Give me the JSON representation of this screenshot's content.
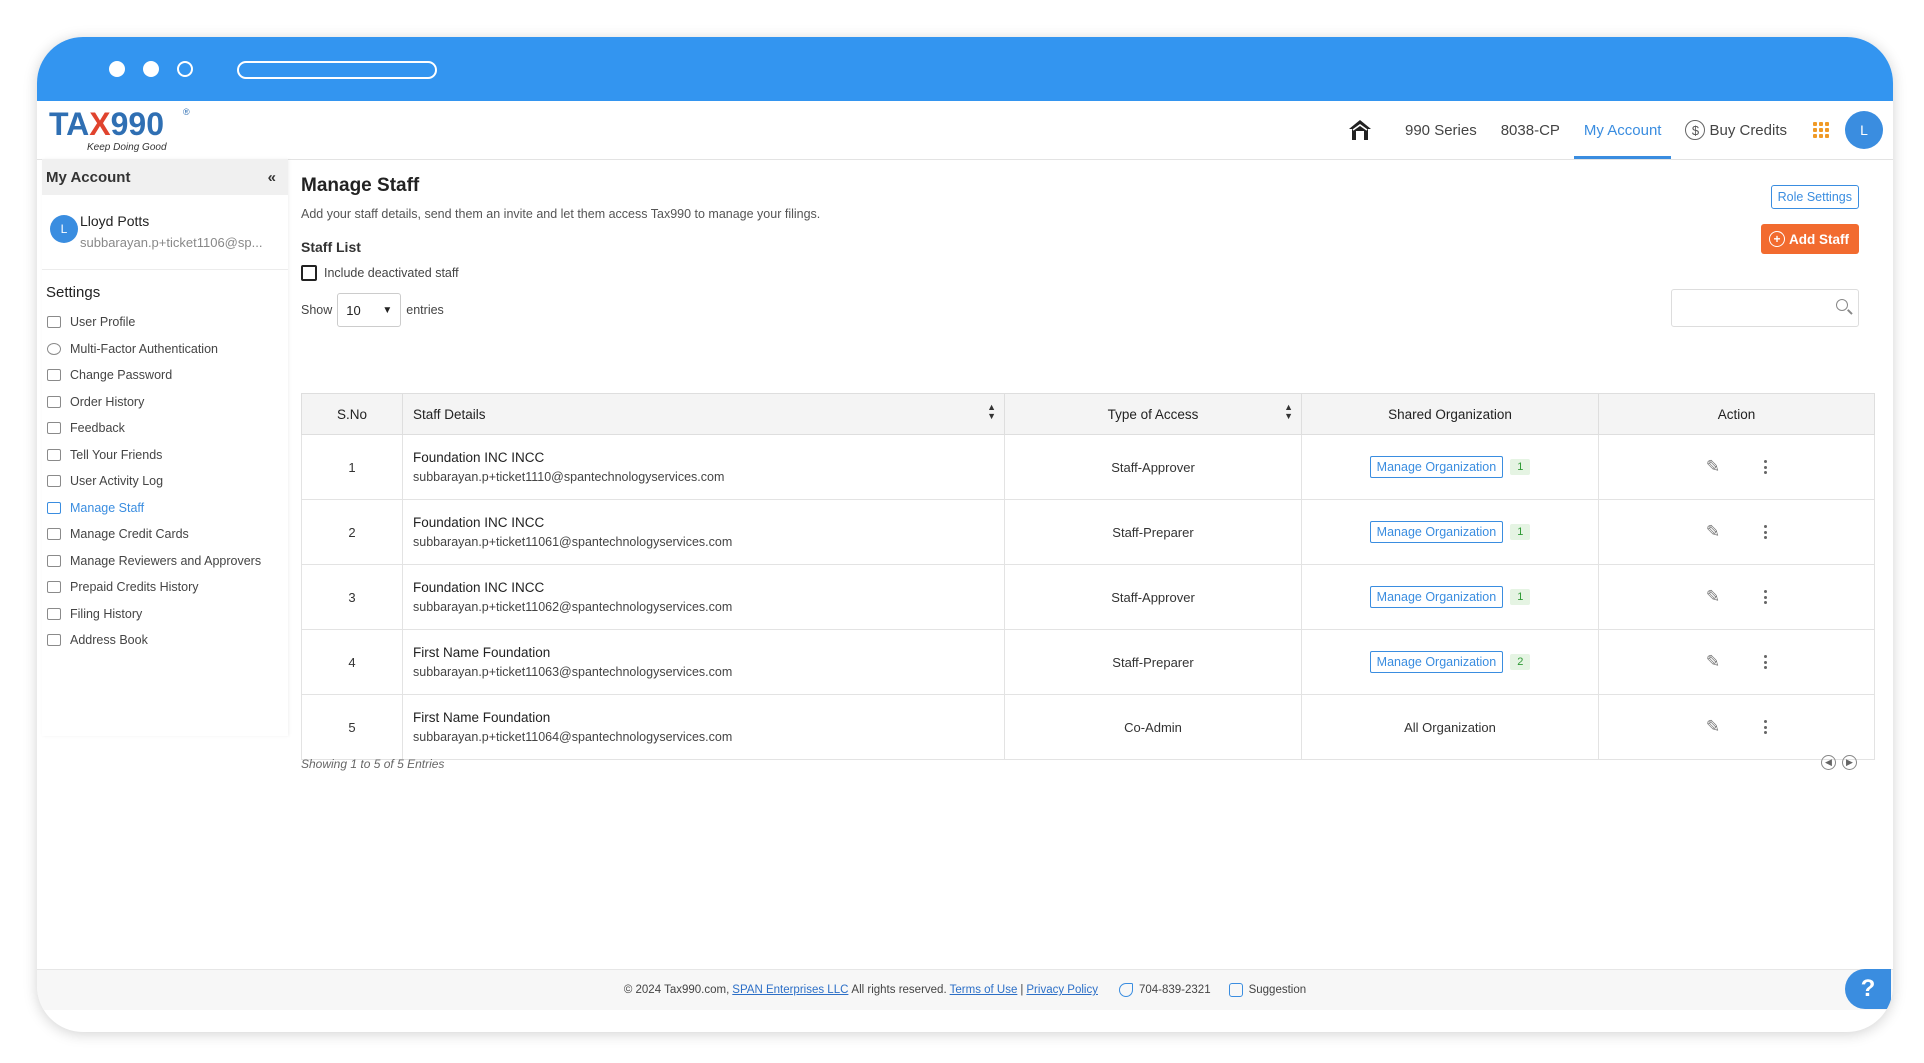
{
  "brand": {
    "logo_text_a": "TA",
    "logo_text_x": "X",
    "logo_text_b": "990",
    "registered": "®",
    "tagline": "Keep Doing Good"
  },
  "topnav": {
    "items": [
      {
        "label": "990 Series"
      },
      {
        "label": "8038-CP"
      },
      {
        "label": "My Account"
      },
      {
        "label": "Buy Credits"
      }
    ],
    "active": "My Account",
    "avatar_initial": "L",
    "coin_symbol": "$"
  },
  "sidebar": {
    "header": "My Account",
    "collapse_glyph": "«",
    "user": {
      "initial": "L",
      "name": "Lloyd Potts",
      "email": "subbarayan.p+ticket1106@sp..."
    },
    "settings_title": "Settings",
    "items": [
      {
        "label": "User Profile"
      },
      {
        "label": "Multi-Factor Authentication"
      },
      {
        "label": "Change Password"
      },
      {
        "label": "Order History"
      },
      {
        "label": "Feedback"
      },
      {
        "label": "Tell Your Friends"
      },
      {
        "label": "User Activity Log"
      },
      {
        "label": "Manage Staff"
      },
      {
        "label": "Manage Credit Cards"
      },
      {
        "label": "Manage Reviewers and Approvers"
      },
      {
        "label": "Prepaid Credits History"
      },
      {
        "label": "Filing History"
      },
      {
        "label": "Address Book"
      }
    ]
  },
  "main": {
    "title": "Manage Staff",
    "subtitle": "Add your staff details, send them an invite and let them access Tax990 to manage your filings.",
    "section": "Staff List",
    "role_settings": "Role Settings",
    "add_staff": "Add Staff",
    "include_deactivated": "Include deactivated staff",
    "show_label": "Show",
    "entries_label": "entries",
    "page_size": "10",
    "search_placeholder": "",
    "columns": {
      "sno": "S.No",
      "details": "Staff Details",
      "access": "Type of Access",
      "shared": "Shared Organization",
      "action": "Action"
    },
    "manage_org_label": "Manage Organization",
    "rows": [
      {
        "sno": "1",
        "name": "Foundation INC INCC",
        "email": "subbarayan.p+ticket1110@spantechnologyservices.com",
        "access": "Staff-Approver",
        "org_count": "1",
        "org_text": ""
      },
      {
        "sno": "2",
        "name": "Foundation INC INCC",
        "email": "subbarayan.p+ticket11061@spantechnologyservices.com",
        "access": "Staff-Preparer",
        "org_count": "1",
        "org_text": ""
      },
      {
        "sno": "3",
        "name": "Foundation INC INCC",
        "email": "subbarayan.p+ticket11062@spantechnologyservices.com",
        "access": "Staff-Approver",
        "org_count": "1",
        "org_text": ""
      },
      {
        "sno": "4",
        "name": "First Name Foundation",
        "email": "subbarayan.p+ticket11063@spantechnologyservices.com",
        "access": "Staff-Preparer",
        "org_count": "2",
        "org_text": ""
      },
      {
        "sno": "5",
        "name": "First Name Foundation",
        "email": "subbarayan.p+ticket11064@spantechnologyservices.com",
        "access": "Co-Admin",
        "org_count": "",
        "org_text": "All Organization"
      }
    ],
    "showing": "Showing 1 to 5 of 5 Entries"
  },
  "footer": {
    "copyright": "© 2024 Tax990.com,",
    "company_link": "SPAN Enterprises LLC",
    "rights": "All rights reserved.",
    "terms": "Terms of Use",
    "separator": "|",
    "privacy": "Privacy Policy",
    "phone": "704-839-2321",
    "suggestion": "Suggestion"
  },
  "help_glyph": "?",
  "colors": {
    "chrome": "#3395f0",
    "accent": "#3a8de0",
    "add_button": "#f26b2f",
    "badge_bg": "#e5f4e3"
  }
}
